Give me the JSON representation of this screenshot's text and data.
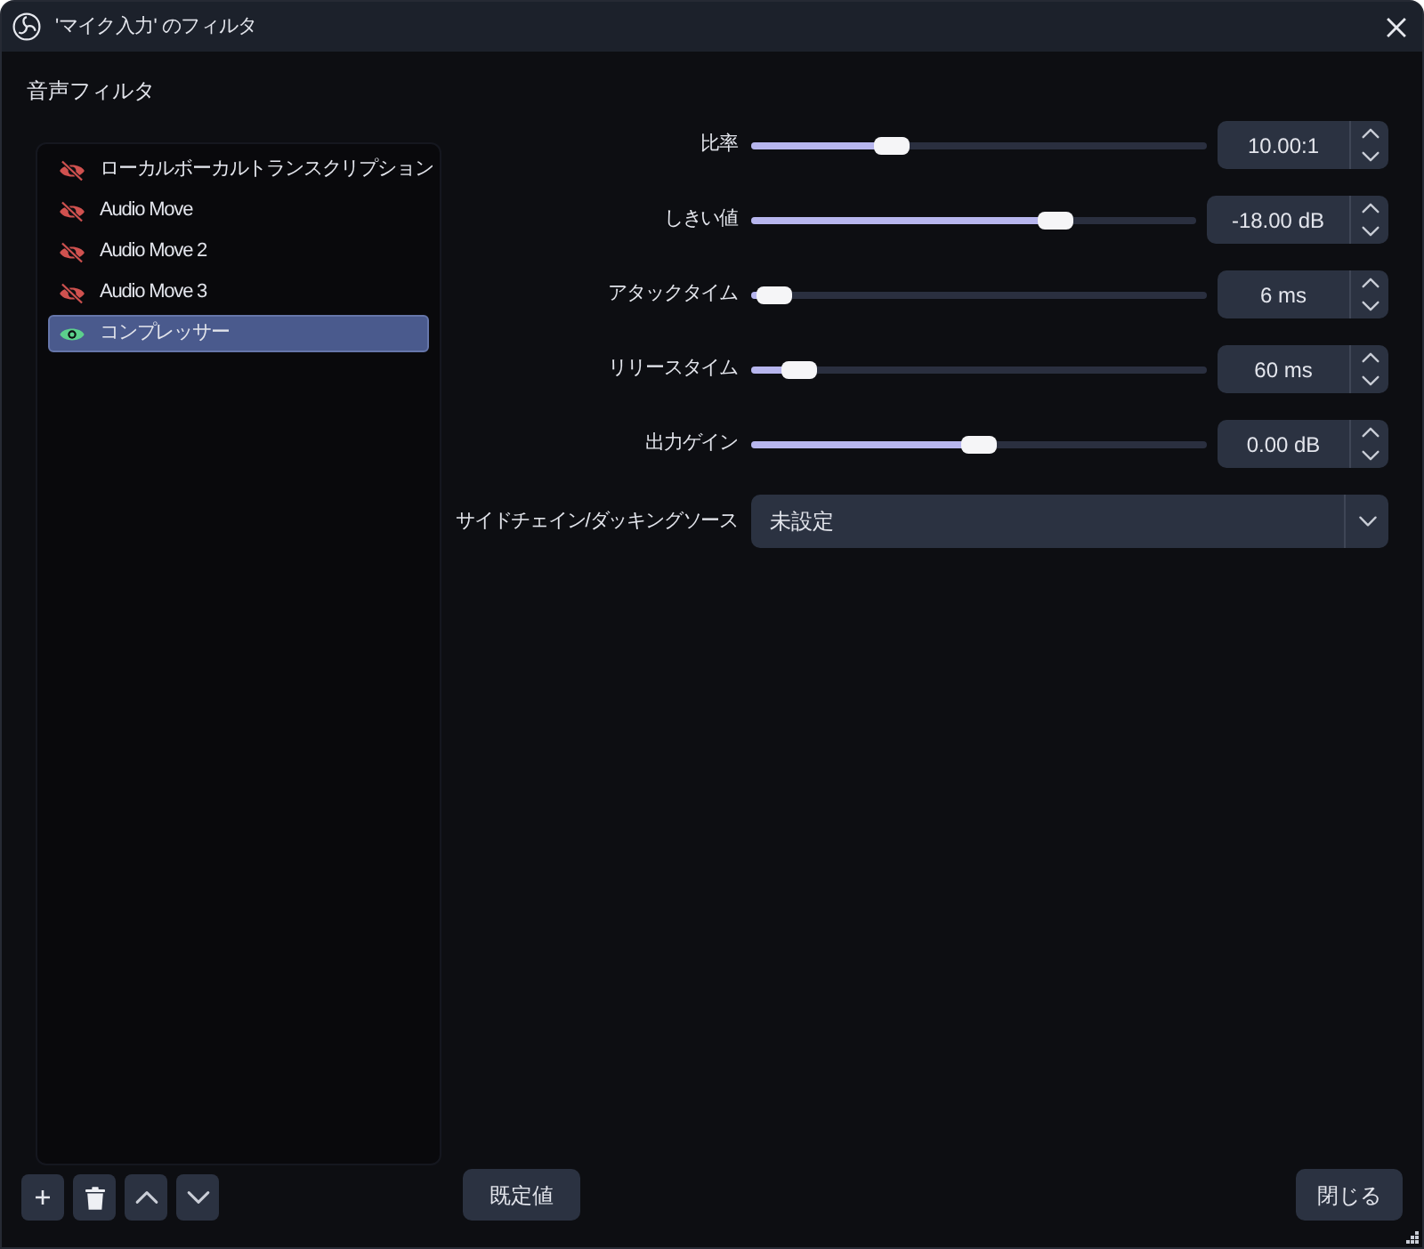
{
  "window": {
    "title": "'マイク入力' のフィルタ"
  },
  "filter_list": {
    "heading": "音声フィルタ",
    "items": [
      {
        "label": "ローカルボーカルトランスクリプション",
        "visible": false,
        "selected": false
      },
      {
        "label": "Audio Move",
        "visible": false,
        "selected": false
      },
      {
        "label": "Audio Move 2",
        "visible": false,
        "selected": false
      },
      {
        "label": "Audio Move 3",
        "visible": false,
        "selected": false
      },
      {
        "label": "コンプレッサー",
        "visible": true,
        "selected": true
      }
    ]
  },
  "settings": [
    {
      "kind": "slider",
      "label": "比率",
      "level": 0.29,
      "value": "10.00:1"
    },
    {
      "kind": "slider",
      "label": "しきい値",
      "level": 0.7,
      "value": "-18.00 dB"
    },
    {
      "kind": "slider",
      "label": "アタックタイム",
      "level": 0.01,
      "value": "6 ms"
    },
    {
      "kind": "slider",
      "label": "リリースタイム",
      "level": 0.07,
      "value": "60 ms"
    },
    {
      "kind": "slider",
      "label": "出力ゲイン",
      "level": 0.5,
      "value": "0.00 dB"
    },
    {
      "kind": "dropdown",
      "label": "サイドチェイン/ダッキングソース",
      "value": "未設定"
    }
  ],
  "buttons": {
    "defaults": "既定値",
    "close": "閉じる"
  }
}
